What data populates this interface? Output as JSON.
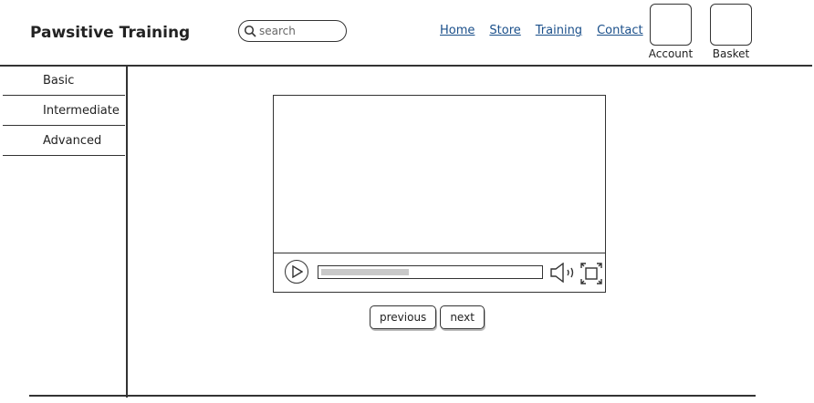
{
  "header": {
    "brand": "Pawsitive Training",
    "search_placeholder": "search",
    "nav": [
      "Home",
      "Store",
      "Training",
      "Contact"
    ],
    "account_label": "Account",
    "basket_label": "Basket"
  },
  "sidebar": {
    "items": [
      {
        "label": "Basic"
      },
      {
        "label": "Intermediate"
      },
      {
        "label": "Advanced"
      }
    ]
  },
  "player": {
    "progress": 0.4
  },
  "pager": {
    "previous_label": "previous",
    "next_label": "next"
  },
  "colors": {
    "link": "#1a4f8a",
    "progress_fill": "#c9c9c9",
    "line": "#333333"
  }
}
